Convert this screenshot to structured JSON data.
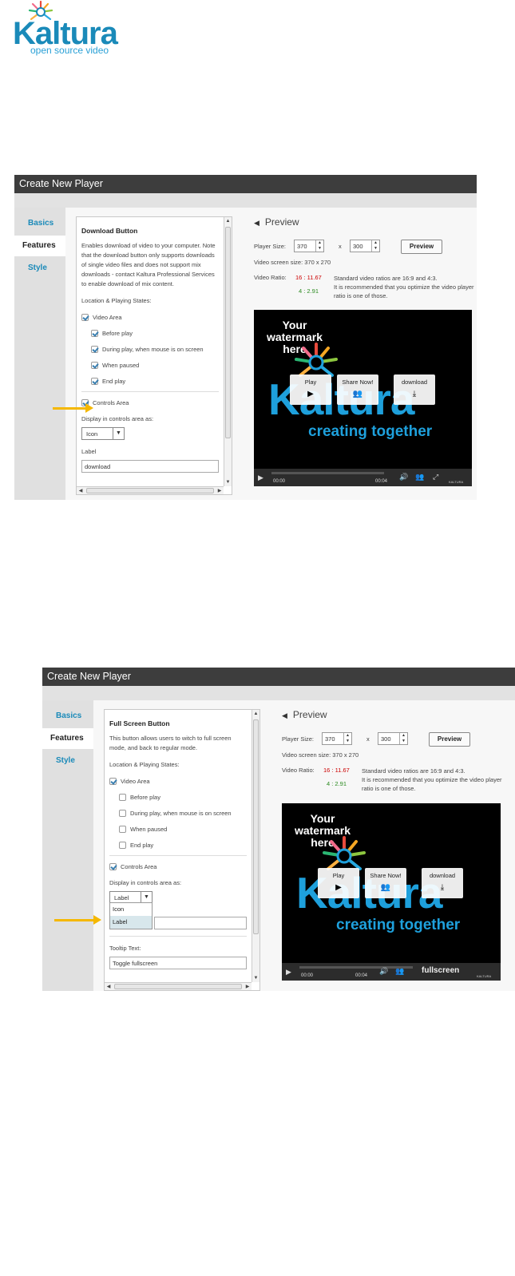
{
  "logo": {
    "word": "Kaltura",
    "tagline": "open source video"
  },
  "screens": [
    {
      "title": "Create New Player",
      "nav": [
        "Basics",
        "Features",
        "Style"
      ],
      "active_nav": 1,
      "section_title": "Download Button",
      "description": "Enables download of video to your computer. Note that the download button only supports downloads of single video files and does not support mix downloads - contact Kaltura Professional Services to enable download of mix content.",
      "location_label": "Location & Playing States:",
      "video_area": "Video Area",
      "states": [
        "Before play",
        "During play, when mouse is on screen",
        "When paused",
        "End play"
      ],
      "controls_area": "Controls Area",
      "display_label": "Display in controls area as:",
      "display_value": "Icon",
      "label_heading": "Label",
      "label_value": "download"
    },
    {
      "title": "Create New Player",
      "nav": [
        "Basics",
        "Features",
        "Style"
      ],
      "active_nav": 1,
      "section_title": "Full Screen Button",
      "description": "This button allows users to witch to full screen mode, and back to regular mode.",
      "location_label": "Location & Playing States:",
      "video_area": "Video Area",
      "states": [
        "Before play",
        "During play, when mouse is on screen",
        "When paused",
        "End play"
      ],
      "controls_area": "Controls Area",
      "display_label": "Display in controls area as:",
      "display_value": "Label",
      "dropdown_options": [
        "Icon",
        "Label"
      ],
      "tooltip_heading": "Tooltip Text:",
      "tooltip_value": "Toggle fullscreen"
    }
  ],
  "preview": {
    "title": "Preview",
    "player_size_label": "Player Size:",
    "width": "370",
    "x": "x",
    "height": "300",
    "preview_button": "Preview",
    "screen_size": "Video screen size: 370 x 270",
    "ratio_label": "Video Ratio:",
    "ratio_red": "16 : 11.67",
    "ratio_green": "4 : 2.91",
    "ratio_note_1": "Standard video ratios are 16:9 and 4:3.",
    "ratio_note_2": "It is recommended that you optimize the video player",
    "ratio_note_3": "ratio is one of those."
  },
  "player": {
    "watermark": [
      "Your",
      "watermark",
      "here"
    ],
    "brand": "Kaltura",
    "slogan": "creating together",
    "buttons": [
      "Play",
      "Share Now!",
      "download"
    ],
    "time_start": "00:00",
    "time_end": "00:04",
    "fullscreen_label": "fullscreen",
    "corner_brand": "KALTURA"
  },
  "colors": {
    "accent": "#1a8ab9",
    "header": "#3d3d3d",
    "annotation": "#f5b800",
    "ratio_red": "#cc0000",
    "ratio_green": "#2a8a1f"
  }
}
